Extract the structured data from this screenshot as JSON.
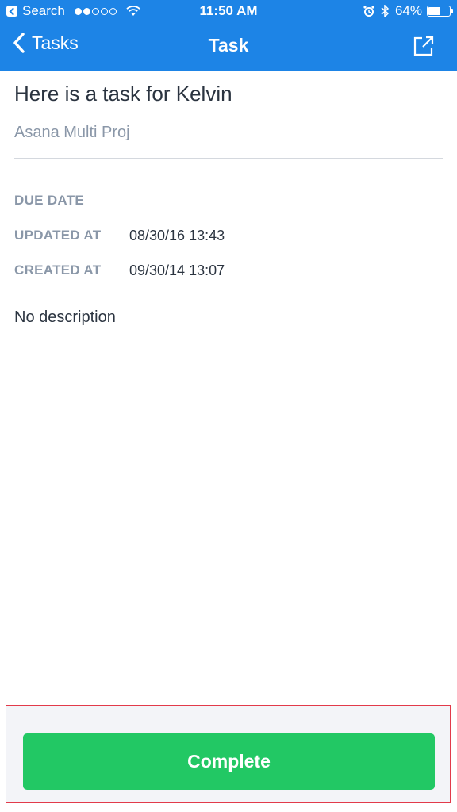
{
  "status_bar": {
    "back_app": "Search",
    "time": "11:50 AM",
    "battery": "64%",
    "battery_level": 0.64,
    "signal_bars_filled": 2,
    "signal_bars_total": 5
  },
  "nav": {
    "back_label": "Tasks",
    "title": "Task",
    "share_icon": "share-icon"
  },
  "task": {
    "name": "Here is a task for Kelvin",
    "project": "Asana Multi Proj",
    "fields": [
      {
        "label": "DUE DATE",
        "value": ""
      },
      {
        "label": "UPDATED AT",
        "value": "08/30/16 13:43"
      },
      {
        "label": "CREATED AT",
        "value": "09/30/14 13:07"
      }
    ],
    "description": "No description"
  },
  "actions": {
    "complete_label": "Complete"
  },
  "colors": {
    "nav_blue": "#1d84e6",
    "complete_green": "#22c864",
    "label_gray": "#8a97a8"
  }
}
